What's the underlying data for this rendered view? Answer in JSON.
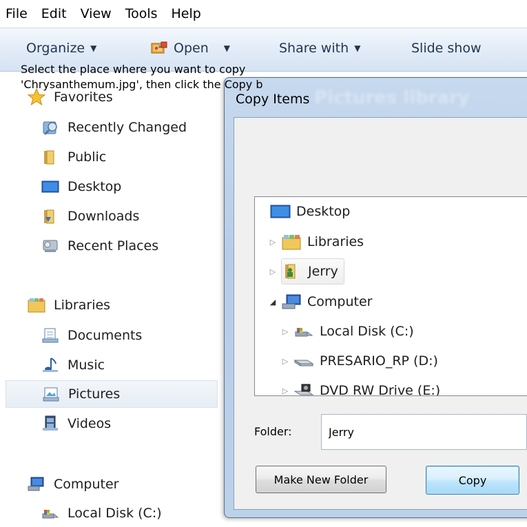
{
  "menubar": {
    "items": [
      "File",
      "Edit",
      "View",
      "Tools",
      "Help"
    ]
  },
  "commandbar": {
    "organize": "Organize",
    "open": "Open",
    "share_with": "Share with",
    "slide_show": "Slide show"
  },
  "navpane": {
    "favorites": {
      "label": "Favorites",
      "items": [
        "Recently Changed",
        "Public",
        "Desktop",
        "Downloads",
        "Recent Places"
      ]
    },
    "libraries": {
      "label": "Libraries",
      "items": [
        "Documents",
        "Music",
        "Pictures",
        "Videos"
      ],
      "selected": "Pictures"
    },
    "computer": {
      "label": "Computer",
      "items": [
        "Local Disk (C:)"
      ]
    }
  },
  "dialog": {
    "title": "Copy Items",
    "background_title": "Pictures library",
    "instruction_line1": "Select the place where you want to copy",
    "instruction_line2": "'Chrysanthemum.jpg', then click the Copy b",
    "tree": [
      "Desktop",
      "Libraries",
      "Jerry",
      "Computer",
      "Local Disk (C:)",
      "PRESARIO_RP (D:)",
      "DVD RW Drive (E:)"
    ],
    "folder_label": "Folder:",
    "folder_value": "Jerry",
    "make_new_folder": "Make New Folder",
    "copy": "Copy"
  },
  "colors": {
    "commandbar_text": "#1e3653",
    "dialog_frame": "#bcd1ea",
    "accent_blue": "#3c7fb1"
  }
}
